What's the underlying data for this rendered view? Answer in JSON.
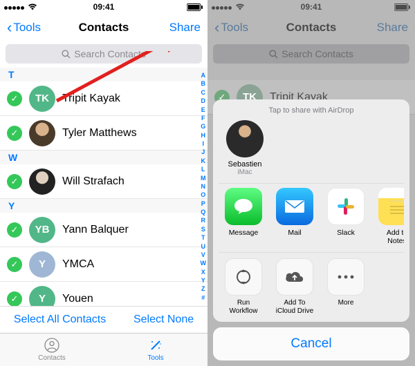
{
  "status": {
    "time": "09:41"
  },
  "nav": {
    "back": "Tools",
    "title": "Contacts",
    "share": "Share"
  },
  "search": {
    "placeholder": "Search Contacts"
  },
  "sections": {
    "t": "T",
    "w": "W",
    "y": "Y"
  },
  "contacts": [
    {
      "name": "Tripit Kayak",
      "initials": "TK",
      "color": "#52b788"
    },
    {
      "name": "Tyler Matthews",
      "photo": true
    },
    {
      "name": "Will Strafach",
      "photo": true
    },
    {
      "name": "Yann Balquer",
      "initials": "YB",
      "color": "#52b788"
    },
    {
      "name": "YMCA",
      "initials": "Y",
      "color": "#9fb7d4"
    },
    {
      "name": "Youen",
      "initials": "Y",
      "color": "#52b788"
    }
  ],
  "index_letters": [
    "A",
    "B",
    "C",
    "D",
    "E",
    "F",
    "G",
    "H",
    "I",
    "J",
    "K",
    "L",
    "M",
    "N",
    "O",
    "P",
    "Q",
    "R",
    "S",
    "T",
    "U",
    "V",
    "W",
    "X",
    "Y",
    "Z",
    "#"
  ],
  "bottom": {
    "select_all": "Select All Contacts",
    "select_none": "Select None"
  },
  "tabs": {
    "contacts": "Contacts",
    "tools": "Tools"
  },
  "sheet": {
    "hint": "Tap to share with AirDrop",
    "airdrop": {
      "name": "Sebastien",
      "device": "iMac"
    },
    "apps": [
      {
        "label": "Message"
      },
      {
        "label": "Mail"
      },
      {
        "label": "Slack"
      },
      {
        "label": "Add to Notes"
      }
    ],
    "actions": [
      {
        "label": "Run Workflow"
      },
      {
        "label": "Add To iCloud Drive"
      },
      {
        "label": "More"
      }
    ],
    "cancel": "Cancel"
  }
}
